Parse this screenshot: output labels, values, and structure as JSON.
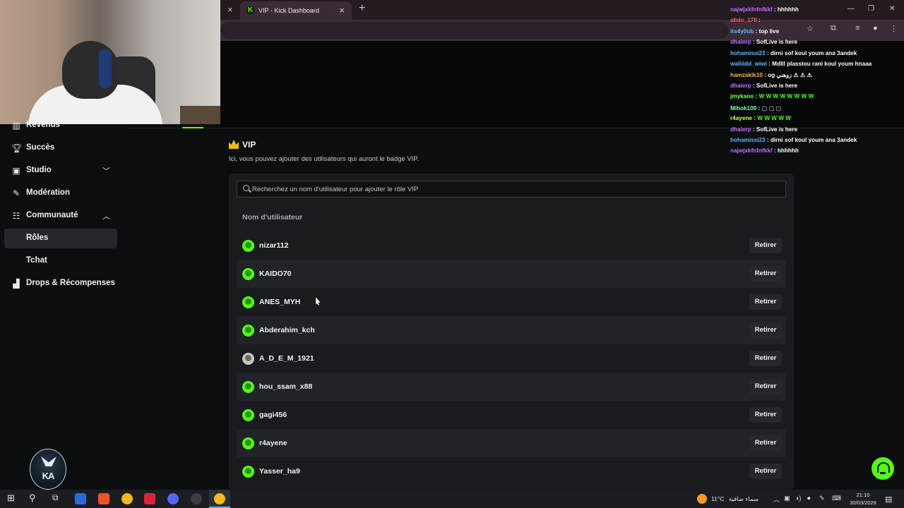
{
  "browser": {
    "tab_title": "VIP - Kick Dashboard",
    "tab_close_glyph": "×",
    "new_tab_glyph": "+"
  },
  "sidebar": {
    "items": [
      {
        "label": "Revenus",
        "icon": "revenue-icon"
      },
      {
        "label": "Succès",
        "icon": "trophy-icon"
      },
      {
        "label": "Studio",
        "icon": "studio-icon",
        "chevron": "down"
      },
      {
        "label": "Modération",
        "icon": "wrench-icon"
      },
      {
        "label": "Communauté",
        "icon": "community-icon",
        "chevron": "up"
      },
      {
        "label": "Rôles",
        "active": true
      },
      {
        "label": "Tchat"
      },
      {
        "label": "Drops & Récompenses",
        "icon": "drops-icon"
      }
    ]
  },
  "vip": {
    "title": "VIP",
    "description": "Ici, vous pouvez ajouter des utilisateurs qui auront le badge VIP.",
    "search_placeholder": "Recherchez un nom d'utilisateur pour ajouter le rôle VIP",
    "column_header": "Nom d'utilisateur",
    "remove_label": "Retirer",
    "users": [
      {
        "name": "nizar112",
        "avatar": "kick-green"
      },
      {
        "name": "KAIDO70",
        "avatar": "kick-green"
      },
      {
        "name": "ANES_MYH",
        "avatar": "kick-green"
      },
      {
        "name": "Abderahim_kch",
        "avatar": "kick-green"
      },
      {
        "name": "A_D_E_M_1921",
        "avatar": "photo"
      },
      {
        "name": "hou_ssam_x88",
        "avatar": "kick-green"
      },
      {
        "name": "gagi456",
        "avatar": "kick-green"
      },
      {
        "name": "r4ayene",
        "avatar": "kick-green"
      },
      {
        "name": "Yasser_ha9",
        "avatar": "kick-green"
      }
    ]
  },
  "chat": {
    "lines": [
      {
        "user": "najwjxkfnfnfkkf",
        "msg": "hhhhhh",
        "color": "#c86cff"
      },
      {
        "user": "abdo_178",
        "msg": "",
        "color": "#ff5a5a"
      },
      {
        "user": "its4y0ub",
        "msg": "top live",
        "color": "#5ab8ff"
      },
      {
        "user": "dhaierp",
        "msg": "SofLive is here",
        "color": "#c86cff"
      },
      {
        "user": "hohamissi23",
        "msg": "dirni sof koul youm ana 3andek",
        "color": "#5ab8ff"
      },
      {
        "user": "waliiidd_wiwi",
        "msg": "Mdlll plasstou rani koul youm hnaaa",
        "color": "#5ab8ff"
      },
      {
        "user": "hamzakik10",
        "msg": "og زوهني ⚠ ⚠ ⚠",
        "color": "#ffb347"
      },
      {
        "user": "dhaierp",
        "msg": "SofLive is here",
        "color": "#c86cff"
      },
      {
        "user": "jmykano",
        "msg": "W W W W W W W W",
        "color": "#7cff5a"
      },
      {
        "user": "Mihok100",
        "msg": "▢ ▢ ▢",
        "color": "#7cffb0"
      },
      {
        "user": "r4ayene",
        "msg": "W W W W W",
        "color": "#c8ff5a"
      },
      {
        "user": "dhaierp",
        "msg": "SofLive is here",
        "color": "#c86cff"
      },
      {
        "user": "hohamissi23",
        "msg": "dirni sof koul youm ana 3andek",
        "color": "#5ab8ff"
      },
      {
        "user": "najwjxkfnfnfkkf",
        "msg": "hhhhhh",
        "color": "#c86cff"
      }
    ]
  },
  "taskbar": {
    "weather_temp": "11°C",
    "weather_condition": "سماء صافية",
    "time": "21:10",
    "date": "30/03/2026"
  },
  "colors": {
    "accent": "#53fc18",
    "crown": "#f5b91c"
  }
}
